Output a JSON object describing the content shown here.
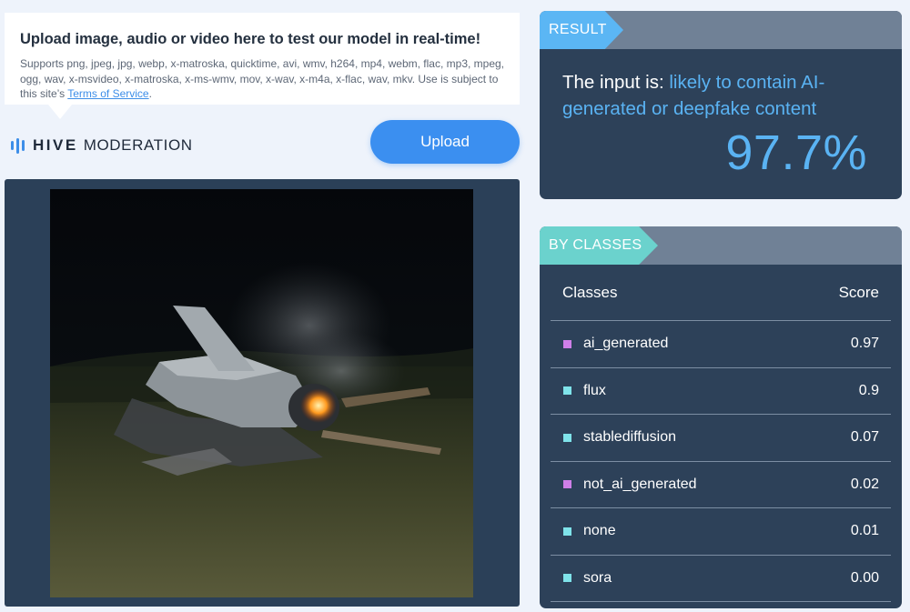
{
  "upload": {
    "title": "Upload image, audio or video here to test our model in real-time!",
    "supported_text": "Supports png, jpeg, jpg, webp, x-matroska, quicktime, avi, wmv, h264, mp4, webm, flac, mp3, mpeg, ogg, wav, x-msvideo, x-matroska, x-ms-wmv, mov, x-wav, x-m4a, x-flac, wav, mkv. Use is subject to this site’s ",
    "terms_link": "Terms of Service",
    "terms_suffix": ".",
    "button_label": "Upload"
  },
  "logo": {
    "brand": "HIVE",
    "product": "MODERATION",
    "icon": "hive-bars-icon"
  },
  "preview": {
    "description_icon": "uploaded-image"
  },
  "result": {
    "tag": "RESULT",
    "prefix": "The input is: ",
    "verdict": "likely to contain AI-generated or deepfake content",
    "score": "97.7%"
  },
  "classes": {
    "tag": "BY CLASSES",
    "col_class": "Classes",
    "col_score": "Score",
    "rows": [
      {
        "label": "ai_generated",
        "score": "0.97",
        "color": "#cf7fe8"
      },
      {
        "label": "flux",
        "score": "0.9",
        "color": "#7fe3ea"
      },
      {
        "label": "stablediffusion",
        "score": "0.07",
        "color": "#7fe3ea"
      },
      {
        "label": "not_ai_generated",
        "score": "0.02",
        "color": "#cf7fe8"
      },
      {
        "label": "none",
        "score": "0.01",
        "color": "#7fe3ea"
      },
      {
        "label": "sora",
        "score": "0.00",
        "color": "#7fe3ea"
      }
    ]
  },
  "colors": {
    "accent": "#3b8ff0",
    "result_blue": "#5ab3f3",
    "classes_teal": "#6bd2cd",
    "panel": "#2d4159"
  }
}
